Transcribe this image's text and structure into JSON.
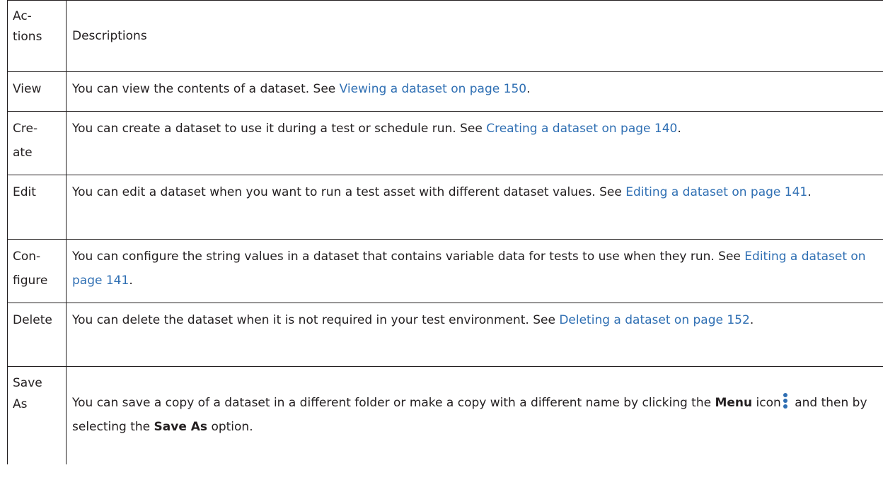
{
  "table": {
    "header": {
      "actions": "Ac-\ntions",
      "descriptions": "Descriptions"
    },
    "rows": [
      {
        "action": "View",
        "text_before": "You can view the contents of a dataset. See ",
        "link": "Viewing a dataset on page 150",
        "text_after": "."
      },
      {
        "action": "Cre-\nate",
        "text_before": "You can create a dataset to use it during a test or schedule run. See ",
        "link": "Creating a dataset on page 140",
        "text_after": "."
      },
      {
        "action": "Edit",
        "text_before": "You can edit a dataset when you want to run a test asset with different dataset values. See ",
        "link": "Editing a dataset on page 141",
        "text_after": "."
      },
      {
        "action": "Con-\nfigure",
        "text_before": "You can configure the string values in a dataset that contains variable data for tests to use when they run. See ",
        "link": "Editing a dataset on page 141",
        "text_after": "."
      },
      {
        "action": "Delete",
        "text_before": "You can delete the dataset when it is not required in your test environment. See ",
        "link": "Deleting a dataset on page 152",
        "text_after": "."
      },
      {
        "action": "Save\nAs",
        "text_part1": "You can save a copy of a dataset in a different folder or make a copy with a different name by clicking the ",
        "bold1": "Menu",
        "text_part2": " icon",
        "text_part3": " and then by selecting the ",
        "bold2": "Save As",
        "text_part4": " option."
      }
    ]
  },
  "colors": {
    "text": "#231f20",
    "link": "#2f6fb3",
    "menu_icon": "#2f6fb3",
    "border": "#231f20"
  },
  "icons": {
    "menu": "vertical-ellipsis-icon"
  }
}
